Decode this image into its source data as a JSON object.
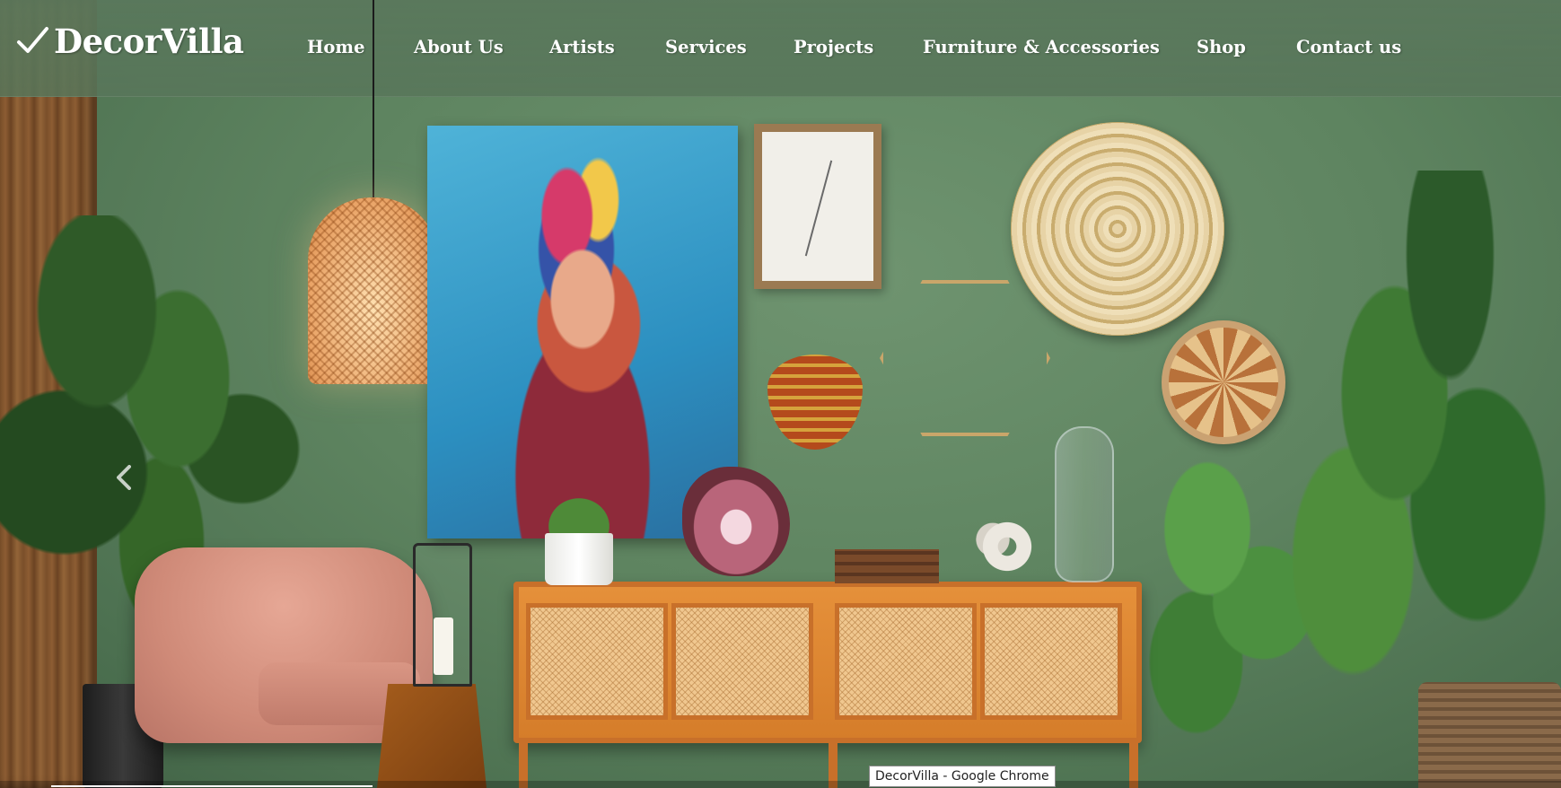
{
  "brand": {
    "name": "DecorVilla",
    "icon": "checkmark-icon"
  },
  "nav": {
    "items": [
      {
        "label": "Home"
      },
      {
        "label": "About Us"
      },
      {
        "label": "Artists"
      },
      {
        "label": "Services"
      },
      {
        "label": "Projects"
      },
      {
        "label": "Furniture & Accessories"
      },
      {
        "label": "Shop"
      },
      {
        "label": "Contact us"
      }
    ]
  },
  "carousel": {
    "prev_icon": "chevron-left-icon"
  },
  "tooltip": {
    "text": "DecorVilla - Google Chrome"
  },
  "colors": {
    "nav_text": "#ffffff",
    "wall_green": "#5e8460",
    "tooltip_bg": "#ffffff"
  }
}
